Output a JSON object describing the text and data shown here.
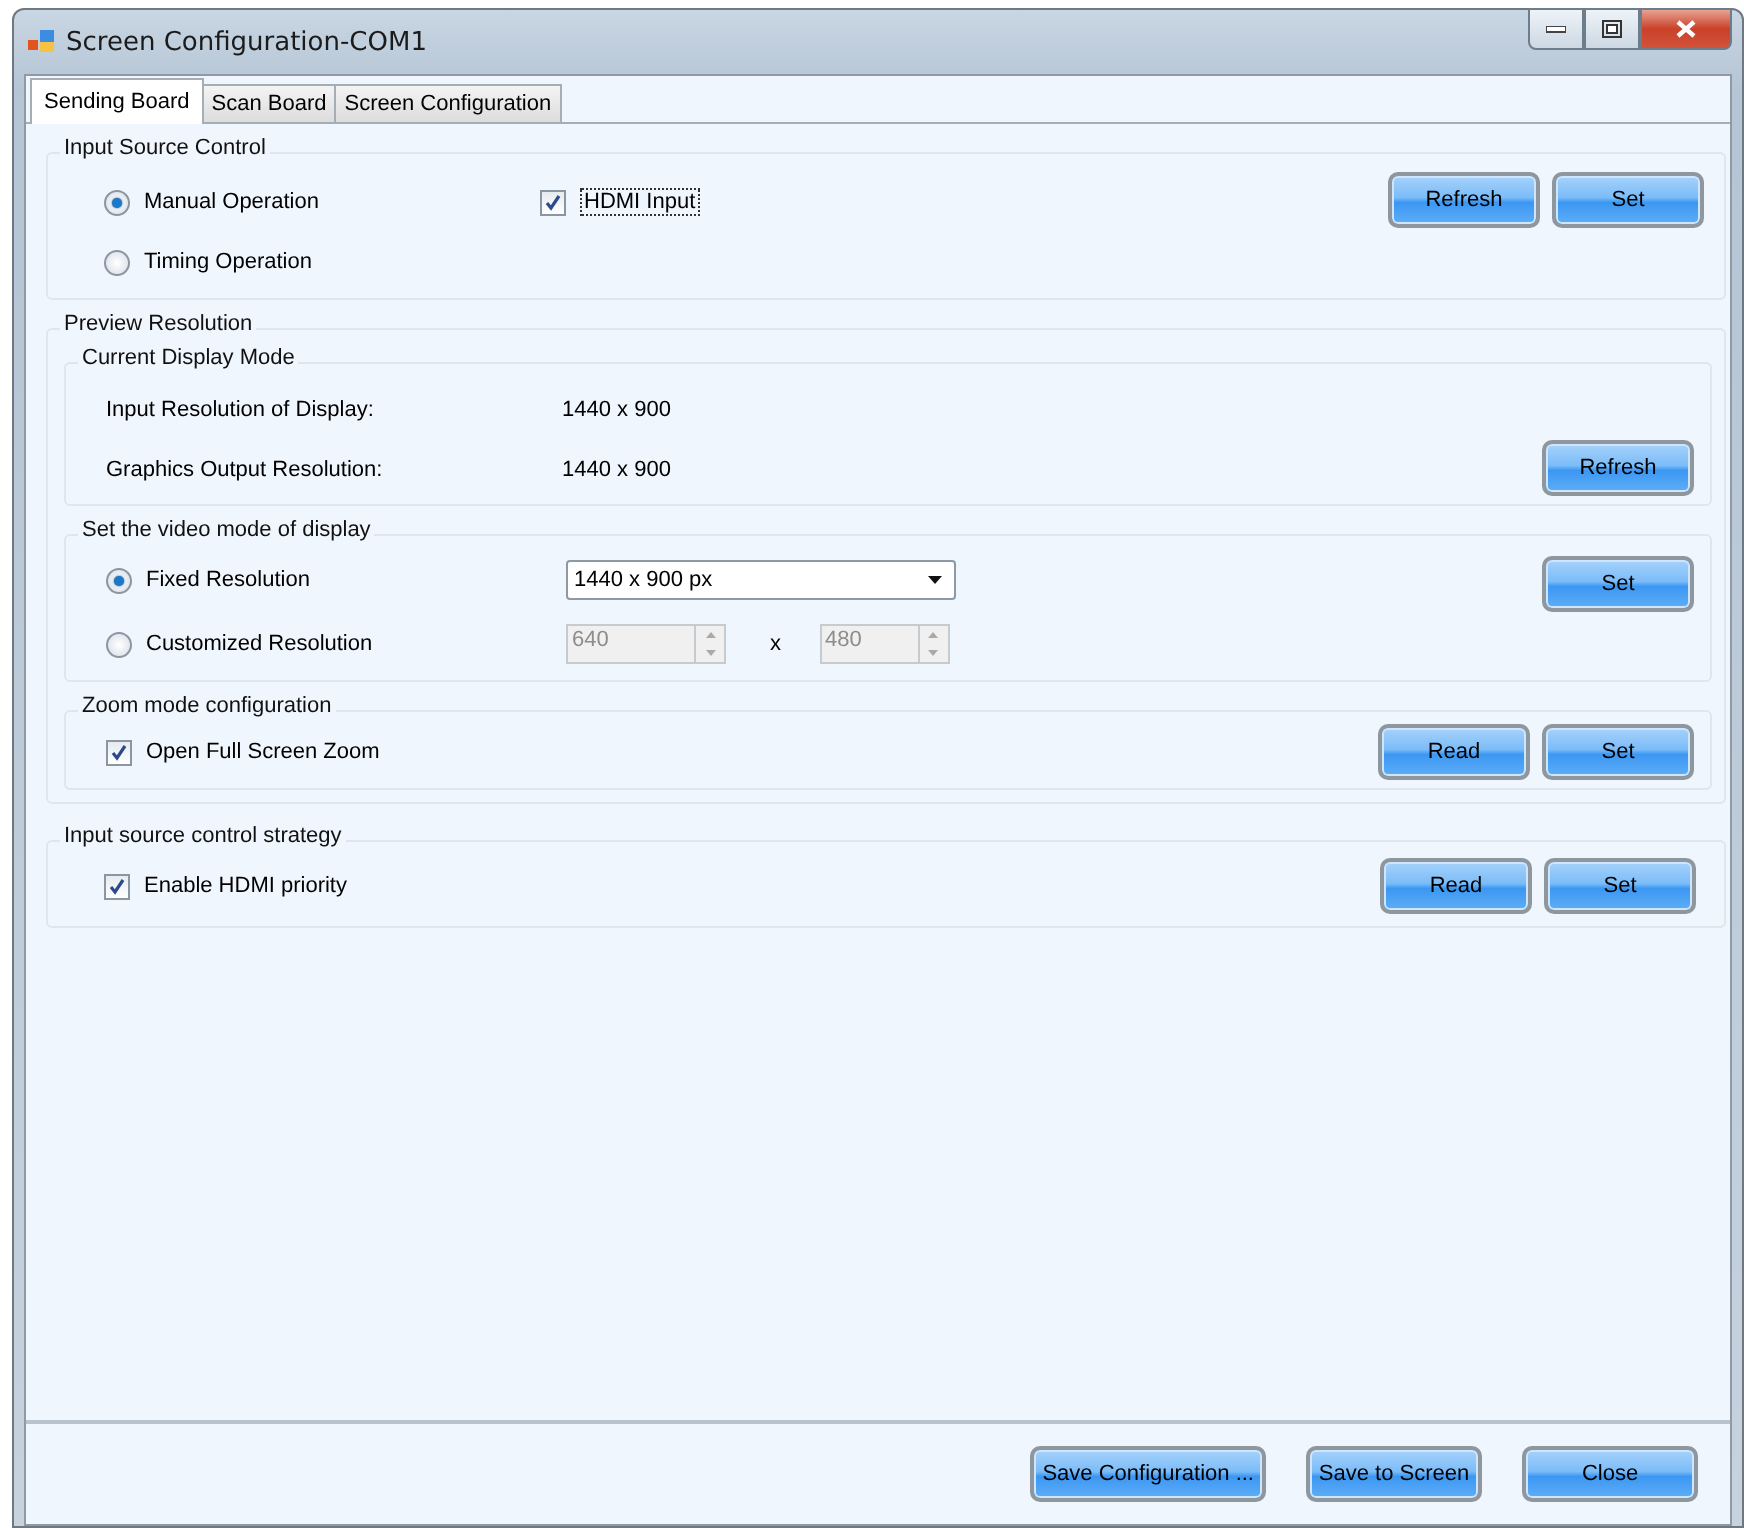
{
  "window": {
    "title": "Screen Configuration-COM1"
  },
  "tabs": [
    {
      "label": "Sending Board",
      "selected": true
    },
    {
      "label": "Scan Board",
      "selected": false
    },
    {
      "label": "Screen Configuration",
      "selected": false
    }
  ],
  "input_source_control": {
    "title": "Input Source Control",
    "options": [
      {
        "label": "Manual Operation",
        "selected": true
      },
      {
        "label": "Timing Operation",
        "selected": false
      }
    ],
    "hdmi_input": {
      "label": "HDMI Input",
      "checked": true
    },
    "buttons": [
      "Refresh",
      "Set"
    ]
  },
  "preview_resolution": {
    "title": "Preview Resolution",
    "current_display_mode": {
      "title": "Current Display Mode",
      "rows": [
        {
          "label": "Input Resolution of Display:",
          "value": "1440 x 900"
        },
        {
          "label": "Graphics Output Resolution:",
          "value": "1440 x 900"
        }
      ],
      "button": "Refresh"
    },
    "video_mode": {
      "title": "Set the video mode of display",
      "options": [
        {
          "label": "Fixed Resolution",
          "selected": true
        },
        {
          "label": "Customized Resolution",
          "selected": false
        }
      ],
      "dropdown": {
        "value": "1440 x 900 px"
      },
      "width": {
        "value": "640",
        "disabled": true
      },
      "separator": "x",
      "height": {
        "value": "480",
        "disabled": true
      },
      "button": "Set"
    },
    "zoom_mode": {
      "title": "Zoom mode configuration",
      "checkbox": {
        "label": "Open Full Screen Zoom",
        "checked": true
      },
      "buttons": [
        "Read",
        "Set"
      ]
    }
  },
  "input_source_strategy": {
    "title": "Input source control strategy",
    "checkbox": {
      "label": "Enable HDMI priority",
      "checked": true
    },
    "buttons": [
      "Read",
      "Set"
    ]
  },
  "footer": {
    "buttons": [
      "Save Configuration ...",
      "Save to Screen",
      "Close"
    ]
  }
}
